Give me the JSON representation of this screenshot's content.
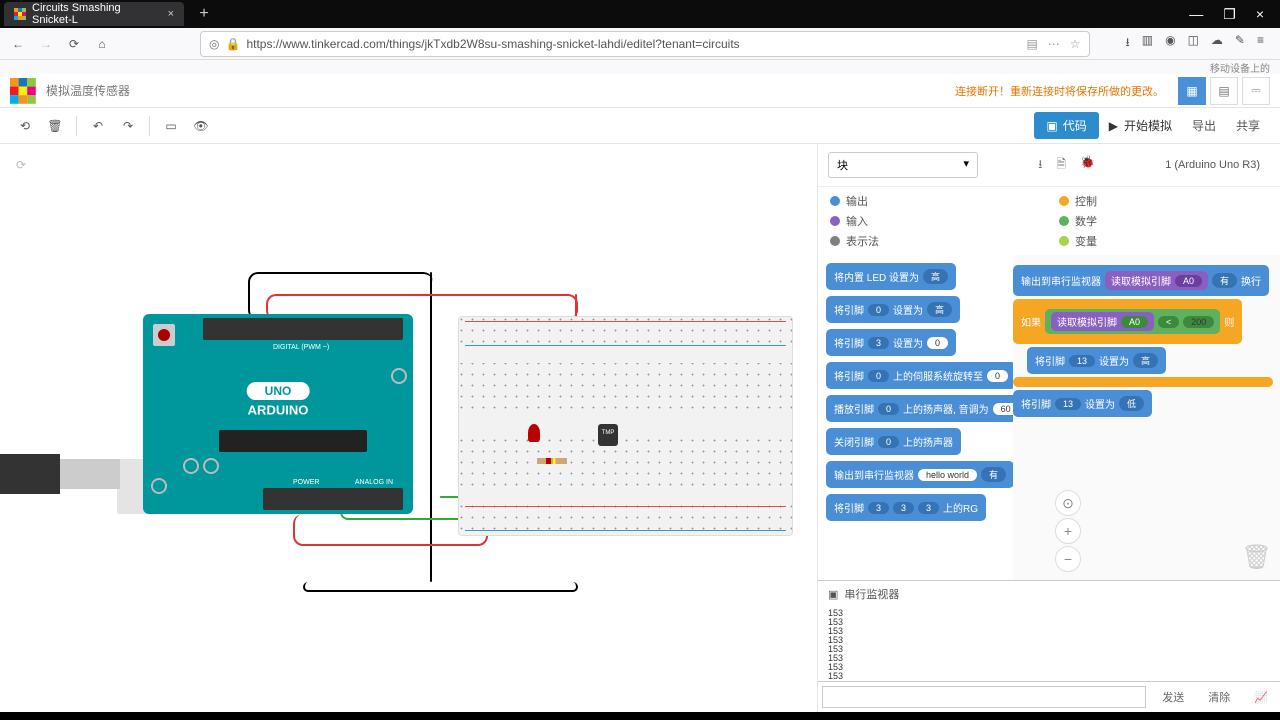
{
  "browser": {
    "tab_title": "Circuits Smashing Snicket-L",
    "url": "https://www.tinkercad.com/things/jkTxdb2W8su-smashing-snicket-lahdi/editel?tenant=circuits",
    "bookmark_toolbar": "移动设备上的"
  },
  "header": {
    "project_title": "模拟温度传感器",
    "disconnect_msg": "连接断开！重新连接时将保存所做的更改。"
  },
  "toolbar": {
    "code_label": "代码",
    "start_sim": "开始模拟",
    "export": "导出",
    "share": "共享"
  },
  "block_panel": {
    "dropdown": "块",
    "board": "1 (Arduino Uno R3)",
    "categories": [
      {
        "label": "输出",
        "color": "#4a8fd6"
      },
      {
        "label": "控制",
        "color": "#f5a623"
      },
      {
        "label": "输入",
        "color": "#8a5fc2"
      },
      {
        "label": "数学",
        "color": "#5fb05f"
      },
      {
        "label": "表示法",
        "color": "#808080"
      },
      {
        "label": "变量",
        "color": "#a6d34a"
      }
    ]
  },
  "palette_blocks": {
    "b1": {
      "t": "将内置 LED 设置为",
      "v": "高"
    },
    "b2": {
      "t": "将引脚",
      "p": "0",
      "t2": "设置为",
      "v": "高"
    },
    "b3": {
      "t": "将引脚",
      "p": "3",
      "t2": "设置为",
      "v": "0"
    },
    "b4": {
      "t": "将引脚",
      "p": "0",
      "t2": "上的伺服系统旋转至",
      "v": "0"
    },
    "b5": {
      "t": "播放引脚",
      "p": "0",
      "t2": "上的扬声器, 音调为",
      "v": "60"
    },
    "b6": {
      "t": "关闭引脚",
      "p": "0",
      "t2": "上的扬声器"
    },
    "b7": {
      "t": "输出到串行监视器",
      "v": "hello world",
      "t2": "有"
    },
    "b8": {
      "t": "将引脚",
      "p": "3",
      "p2": "3",
      "p3": "3",
      "t2": "上的RG"
    }
  },
  "workspace": {
    "s1_out": {
      "t": "输出到串行监视器",
      "inner": "读取模拟引脚",
      "pin": "A0",
      "t2": "有",
      "t3": "换行"
    },
    "s2_if": {
      "t": "如果",
      "inner": "读取模拟引脚",
      "pin": "A0",
      "op": "<",
      "val": "200",
      "t2": "则"
    },
    "s3": {
      "t": "将引脚",
      "p": "13",
      "t2": "设置为",
      "v": "高"
    },
    "s4": {
      "t": "将引脚",
      "p": "13",
      "t2": "设置为",
      "v": "低"
    }
  },
  "arduino": {
    "brand": "ARDUINO",
    "model": "UNO",
    "digital": "DIGITAL (PWM ~)",
    "power": "POWER",
    "analog": "ANALOG IN"
  },
  "serial": {
    "title": "串行监视器",
    "lines": [
      "153",
      "153",
      "153",
      "153",
      "153",
      "153",
      "153",
      "153"
    ],
    "send": "发送",
    "clear": "清除"
  },
  "tmp_label": "TMP"
}
